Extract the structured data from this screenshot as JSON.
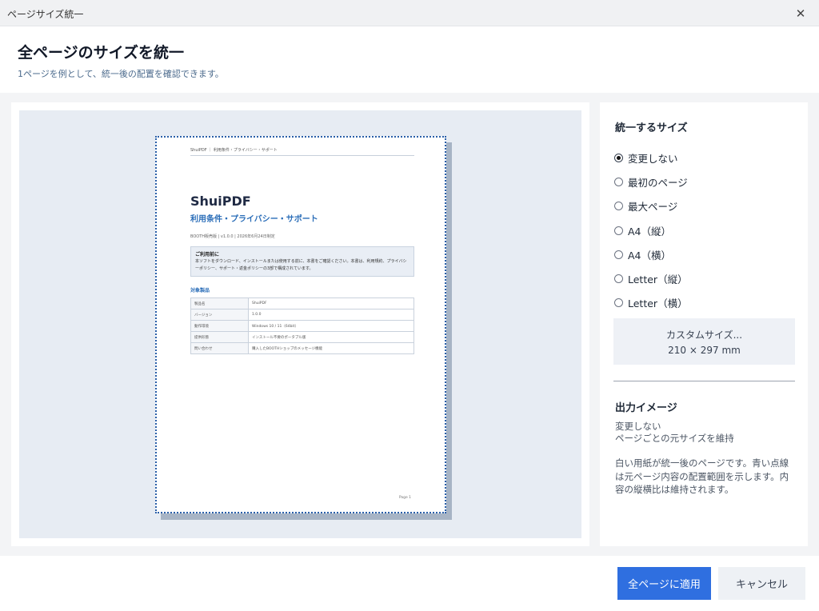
{
  "window": {
    "title": "ページサイズ統一",
    "close_icon": "✕"
  },
  "header": {
    "title": "全ページのサイズを統一",
    "subtitle": "1ページを例として、統一後の配置を確認できます。"
  },
  "preview": {
    "page": {
      "header": "ShuiPDF ｜ 利用条件・プライバシー・サポート",
      "title": "ShuiPDF",
      "subtitle": "利用条件・プライバシー・サポート",
      "meta": "BOOTH販売版 | v1.0.0 | 2026年6月24日制定",
      "notice_title": "ご利用前に",
      "notice_body": "本ソフトをダウンロード、インストールまたは使用する前に、本書をご確認ください。本書は、利用規約、プライバシーポリシー、サポート・返金ポリシーの3部で構成されています。",
      "section_title": "対象製品",
      "table": [
        [
          "製品名",
          "ShuiPDF"
        ],
        [
          "バージョン",
          "1.0.0"
        ],
        [
          "動作環境",
          "Windows 10 / 11（64bit）"
        ],
        [
          "提供形態",
          "インストール不要のポータブル版"
        ],
        [
          "問い合わせ",
          "購入したBOOTHショップのメッセージ機能"
        ]
      ],
      "footer": "Page 1"
    }
  },
  "settings": {
    "size_title": "統一するサイズ",
    "options": [
      "変更しない",
      "最初のページ",
      "最大ページ",
      "A4（縦）",
      "A4（横）",
      "Letter（縦）",
      "Letter（横）"
    ],
    "selected_index": 0,
    "custom_button_label": "カスタムサイズ...",
    "custom_button_size": "210 × 297 mm",
    "output_title": "出力イメージ",
    "output_mode": "変更しない",
    "output_desc": "ページごとの元サイズを維持",
    "output_note": "白い用紙が統一後のページです。青い点線は元ページ内容の配置範囲を示します。内容の縦横比は維持されます。"
  },
  "footer": {
    "apply_label": "全ページに適用",
    "cancel_label": "キャンセル"
  },
  "colors": {
    "primary": "#2f6fe0",
    "preview_bg": "#e7ecf3",
    "page_border": "#2a5fa8"
  }
}
